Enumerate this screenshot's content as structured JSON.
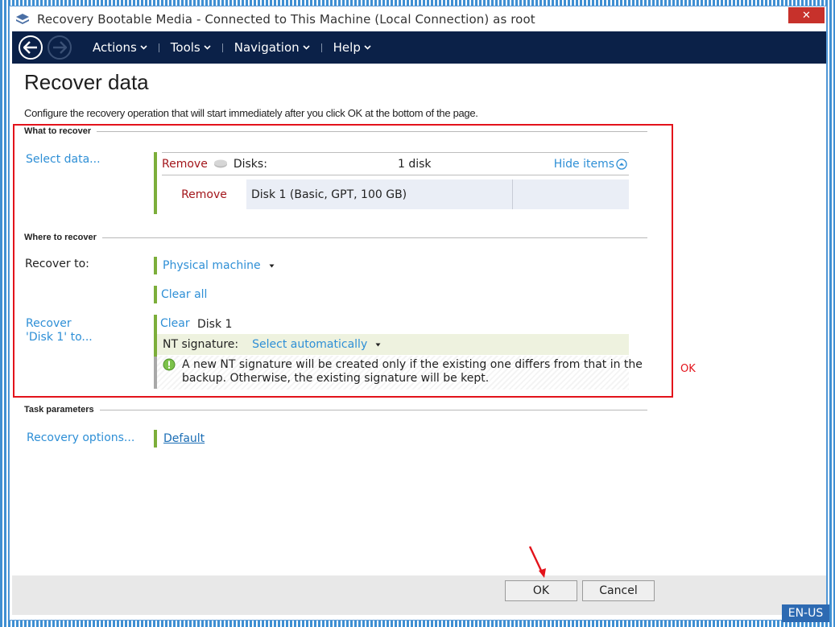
{
  "window": {
    "title": "Recovery Bootable Media - Connected to This Machine (Local Connection) as root",
    "close_label": "✕"
  },
  "menubar": {
    "items": [
      {
        "label": "Actions"
      },
      {
        "label": "Tools"
      },
      {
        "label": "Navigation"
      },
      {
        "label": "Help"
      }
    ]
  },
  "page": {
    "title": "Recover data",
    "description": "Configure the recovery operation that will start immediately after you click OK at the bottom of the page."
  },
  "what_to_recover": {
    "heading": "What to recover",
    "select_data_link": "Select data...",
    "header_remove": "Remove",
    "header_type": "Disks:",
    "header_count": "1 disk",
    "hide_items": "Hide items",
    "row_remove": "Remove",
    "row_disk": "Disk 1 (Basic, GPT, 100 GB)"
  },
  "where_to_recover": {
    "heading": "Where to recover",
    "recover_to_label": "Recover to:",
    "recover_to_value": "Physical machine",
    "clear_all": "Clear all",
    "recover_disk_label_line1": "Recover",
    "recover_disk_label_line2": "'Disk 1' to...",
    "clear": "Clear",
    "disk_name": "Disk 1",
    "nt_signature_label": "NT signature:",
    "nt_signature_value": "Select automatically",
    "info_line1": "A new NT signature will be created only if the existing one differs from that in the",
    "info_line2": "backup. Otherwise, the existing signature will be kept."
  },
  "annotation": {
    "ok_note": "OK"
  },
  "task_parameters": {
    "heading": "Task parameters",
    "recovery_options_link": "Recovery options...",
    "recovery_options_value": "Default"
  },
  "footer": {
    "ok_label": "OK",
    "cancel_label": "Cancel",
    "language": "EN-US"
  },
  "colors": {
    "menubar": "#0b2148",
    "link": "#2e8fd6",
    "highlight_box": "#e3131b",
    "green_bar": "#7cae3a"
  }
}
